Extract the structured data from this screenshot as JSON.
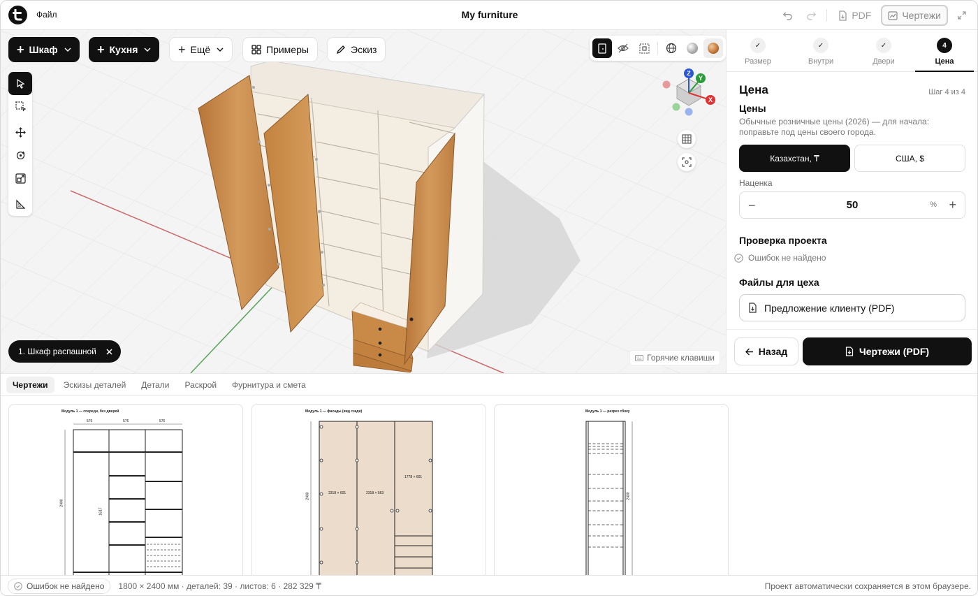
{
  "app": {
    "menu_file": "Файл",
    "title": "My furniture",
    "pdf_label": "PDF",
    "drawings_label": "Чертежи"
  },
  "viewport": {
    "add_buttons": [
      {
        "label": "Шкаф"
      },
      {
        "label": "Кухня"
      },
      {
        "label": "Ещё"
      }
    ],
    "examples_label": "Примеры",
    "sketch_label": "Эскиз",
    "selection_chip": "1. Шкаф распашной",
    "hotkeys_label": "Горячие клавиши",
    "axis_labels": {
      "z": "Z",
      "y": "Y",
      "x": "X"
    }
  },
  "steps": [
    {
      "label": "Размер",
      "done": true
    },
    {
      "label": "Внутри",
      "done": true
    },
    {
      "label": "Двери",
      "done": true
    },
    {
      "label": "Цена",
      "number": "4",
      "active": true
    }
  ],
  "price_panel": {
    "title": "Цена",
    "step_of": "Шаг 4 из 4",
    "prices_heading": "Цены",
    "prices_desc": "Обычные розничные цены (2026) — для начала: поправьте под цены своего города.",
    "regions": [
      {
        "label": "Казахстан, ₸",
        "selected": true
      },
      {
        "label": "США, $",
        "selected": false
      }
    ],
    "markup_label": "Наценка",
    "markup_value": "50",
    "markup_unit": "%",
    "check_heading": "Проверка проекта",
    "check_status": "Ошибок не найдено",
    "files_heading": "Файлы для цеха",
    "client_offer": "Предложение клиенту (PDF)",
    "back_label": "Назад",
    "pdf_drawings_label": "Чертежи (PDF)"
  },
  "bottom_tabs": [
    {
      "label": "Чертежи",
      "active": true
    },
    {
      "label": "Эскизы деталей"
    },
    {
      "label": "Детали"
    },
    {
      "label": "Раскрой"
    },
    {
      "label": "Фурнитура и смета"
    }
  ],
  "sheets": [
    {
      "title": "Модуль 1 — спереди, без дверей",
      "dims": [
        "576",
        "576",
        "576"
      ],
      "height": "2400",
      "inner": "1617"
    },
    {
      "title": "Модуль 1 — фасады (вид сзади)",
      "height": "2400",
      "labels": [
        "2318 × 601",
        "2318 × 563",
        "1778 × 601"
      ]
    },
    {
      "title": "Модуль 1 — разрез сбоку",
      "height": "2400"
    }
  ],
  "status": {
    "ok": "Ошибок не найдено",
    "stats": "1800 × 2400 мм · деталей: 39 · листов: 6 · 282 329 ₸",
    "saved": "Проект автоматически сохраняется в этом браузере."
  },
  "colors": {
    "accent": "#111111",
    "wood": "#c98a48",
    "carcass": "#f6f1e9",
    "facade_fill": "#ecdccb"
  }
}
